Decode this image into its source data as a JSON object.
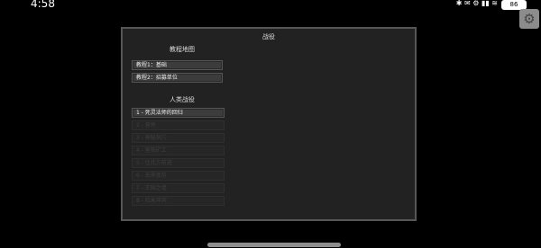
{
  "status": {
    "time": "4:58",
    "icons": "✱ ✉ ⚙ ▮▮ ≋",
    "battery": "86"
  },
  "panel": {
    "title": "战役",
    "tutorial": {
      "title": "教程地图",
      "items": [
        {
          "label": "教程1：基础",
          "enabled": true
        },
        {
          "label": "教程2：招募单位",
          "enabled": true
        }
      ]
    },
    "human": {
      "title": "人类战役",
      "items": [
        {
          "label": "1 - 死灵法师的回归",
          "enabled": true
        },
        {
          "label": "2 - 营地",
          "enabled": false
        },
        {
          "label": "3 - 神秘洞穴",
          "enabled": false
        },
        {
          "label": "4 - 营救矿工",
          "enabled": false
        },
        {
          "label": "5 - 往北方前进",
          "enabled": false
        },
        {
          "label": "6 - 去黑夜前",
          "enabled": false
        },
        {
          "label": "7 - 王国之墙",
          "enabled": false
        },
        {
          "label": "8 - 拉米冲突",
          "enabled": false
        }
      ]
    }
  },
  "colors": {
    "background": "#000000",
    "panel": "#222222",
    "panel_border": "#565656",
    "button": "#3c3c3c",
    "button_disabled": "#262626"
  }
}
